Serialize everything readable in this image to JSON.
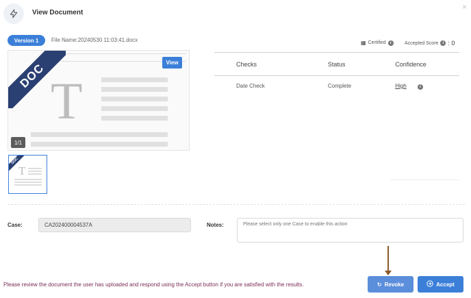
{
  "header": {
    "title": "View Document",
    "icon": "lightning-icon",
    "close_icon": "×"
  },
  "document": {
    "version_label": "Version 1",
    "file_name_label": "File Name:",
    "file_name": "20240530 11:03:41.docx",
    "certified_label": "Certified",
    "accepted_score_label": "Accepted Score",
    "accepted_score_value": ": 0",
    "preview": {
      "ribbon_text": "DOC",
      "letter": "T",
      "view_button": "View",
      "page_counter": "1/1"
    },
    "thumbnail": {
      "ribbon_text": "DOC",
      "letter": "T"
    }
  },
  "checks_table": {
    "headers": [
      "Checks",
      "Status",
      "Confidence"
    ],
    "rows": [
      {
        "check": "Date Check",
        "status": "Complete",
        "confidence": "High"
      }
    ]
  },
  "form": {
    "case_label": "Case:",
    "case_value": "CA202400004537A",
    "notes_label": "Notes:",
    "notes_placeholder": "Please select only one Case to enable this action"
  },
  "footer": {
    "message": "Please review the document the user has uploaded and respond using the Accept button if you are satisfied with the results.",
    "revoke_label": "Revoke",
    "accept_label": "Accept"
  },
  "colors": {
    "primary": "#3b7fd9",
    "ribbon": "#2a3f72",
    "footer_text": "#7a2d55",
    "arrow": "#8a5a2a"
  }
}
